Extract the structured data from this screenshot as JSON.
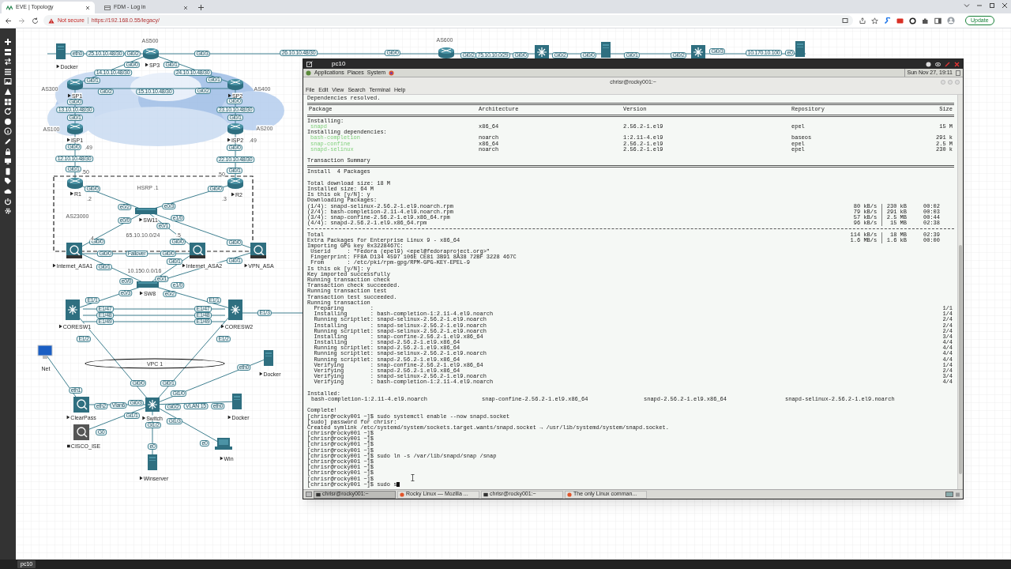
{
  "browser": {
    "tabs": [
      {
        "title": "EVE | Topology",
        "selected": true
      },
      {
        "title": "FDM - Log in",
        "selected": false
      }
    ],
    "security": "Not secure",
    "url": "https://192.168.0.55/legacy/",
    "update_button": "Update"
  },
  "diagram": {
    "nodes": [
      {
        "kind": "server",
        "label": "Docker",
        "stopped": false
      },
      {
        "kind": "router",
        "label": "SP3",
        "stopped": false
      },
      {
        "kind": "router"
      },
      {
        "kind": "l3switch"
      },
      {
        "kind": "server"
      },
      {
        "kind": "l3switch"
      },
      {
        "kind": "server"
      },
      {
        "kind": "router",
        "label": "SP1",
        "stopped": false
      },
      {
        "kind": "router",
        "label": "SP2",
        "stopped": false
      },
      {
        "kind": "router",
        "label": "ISP1",
        "stopped": false
      },
      {
        "kind": "router",
        "label": "ISP2",
        "stopped": false
      },
      {
        "kind": "router",
        "label": "R1",
        "stopped": false
      },
      {
        "kind": "router",
        "label": "R2",
        "stopped": false
      },
      {
        "kind": "switch",
        "label": "SW11",
        "stopped": false
      },
      {
        "kind": "firewall",
        "label": "Internet_ASA1",
        "stopped": false
      },
      {
        "kind": "firewall",
        "label": "Internet_ASA2",
        "stopped": false
      },
      {
        "kind": "firewall",
        "label": "VPN_ASA",
        "stopped": false
      },
      {
        "kind": "switch",
        "label": "SW8",
        "stopped": false
      },
      {
        "kind": "nexus",
        "label": "CORESW1",
        "stopped": false
      },
      {
        "kind": "nexus",
        "label": "CORESW2",
        "stopped": false
      },
      {
        "kind": "monitor",
        "label": "Net"
      },
      {
        "kind": "server",
        "label": "Docker",
        "stopped": false
      },
      {
        "kind": "clearpass",
        "label": "ClearPass",
        "stopped": false
      },
      {
        "kind": "l3switch",
        "label": "Switch",
        "stopped": false
      },
      {
        "kind": "server",
        "label": "Docker",
        "stopped": false
      },
      {
        "kind": "ise",
        "label": "CISCO_ISE",
        "stopped": true
      },
      {
        "kind": "laptop",
        "label": "Win",
        "stopped": false
      },
      {
        "kind": "server",
        "label": "Winserver",
        "stopped": false
      }
    ],
    "tags": [
      "eth0",
      "25.10.10.48/30",
      "Gi0/2",
      "Gi0/3",
      "26.10.10.48/30",
      "Gi0/0",
      "Gi0/2",
      "75.10.10.0/29",
      "Gi0/0",
      "Gi0/2",
      "Gi0/0",
      "Gi0/1",
      "Gi0/2",
      "Gi0/3",
      "10.170.10.100",
      "e0",
      "Gi0/0",
      "Gi0/1",
      "14.10.10.48/30",
      "24.10.10.48/30",
      "Gi0/1",
      "Gi0/1",
      "Gi0/2",
      "15.10.10.48/30",
      "Gi0/2",
      "Gi0/0",
      "Gi0/0",
      "13.10.10.48/30",
      "23.10.10.48/30",
      "Gi0/1",
      "Gi0/1",
      "Gi0/0",
      "Gi0/0",
      "12.10.10.48/30",
      "22.10.10.48/30",
      "Gi0/1",
      "Gi0/1",
      "Gi0/0",
      "Gi0/0",
      "e0/2",
      "e0/3",
      "e0/0",
      "e0/1",
      "e1/0",
      "Gi0/0",
      "Gi0/0",
      "Gi0/0",
      "Gi0/0",
      "Failover",
      "Gi0/0",
      "Gi0/1",
      "Gi0/1",
      "Gi0/1",
      "e0/0",
      "e0/1",
      "e1/0",
      "e0/3",
      "e0/2",
      "E1/1",
      "E1/1",
      "E1/47",
      "E1/48",
      "E1/49",
      "E1/47",
      "E1/48",
      "E1/49",
      "E1/3",
      "E1/2",
      "E1/2",
      "eth0",
      "Gi0/0",
      "Gi0/1",
      "eth1",
      "Gi1/0",
      "Gi0/3",
      "eth2",
      "Vlan6",
      "Gi0/2",
      "VLAN 15",
      "eth0",
      "Gi1/1",
      "Gi1/3",
      "G0",
      "Gi1/2",
      "e0",
      "e0"
    ],
    "annotations": [
      {
        "kind": "text",
        "text": "AS500"
      },
      {
        "kind": "text",
        "text": "AS600"
      },
      {
        "kind": "text",
        "text": "AS300"
      },
      {
        "kind": "text",
        "text": "AS400"
      },
      {
        "kind": "text",
        "text": "AS100"
      },
      {
        "kind": "text",
        "text": "AS200"
      },
      {
        "kind": "text",
        "text": ".49"
      },
      {
        "kind": "text",
        "text": ".49"
      },
      {
        "kind": "text",
        "text": ".50"
      },
      {
        "kind": "text",
        "text": ".50"
      },
      {
        "kind": "text",
        "text": ".2"
      },
      {
        "kind": "text",
        "text": ".3"
      },
      {
        "kind": "text",
        "text": "HSRP .1"
      },
      {
        "kind": "text",
        "text": "AS23000"
      },
      {
        "kind": "text",
        "text": "65.10.10.0/24"
      },
      {
        "kind": "text",
        "text": ".4"
      },
      {
        "kind": "text",
        "text": ".5"
      },
      {
        "kind": "text",
        "text": "10.150.0.0/16"
      },
      {
        "kind": "ellipse",
        "text": "VPC 1"
      }
    ]
  },
  "terminal": {
    "window_title": "pc10",
    "panel_menus": [
      "Applications",
      "Places",
      "System"
    ],
    "clock": "Sun Nov 27, 19:11",
    "title": "chrisr@rocky001:~",
    "menu": [
      "File",
      "Edit",
      "View",
      "Search",
      "Terminal",
      "Help"
    ],
    "lines": [
      {
        "kind": "text",
        "text": "Dependencies resolved."
      },
      {
        "kind": "double_rule"
      },
      {
        "kind": "header",
        "cells": [
          "Package",
          "Architecture",
          "Version",
          "Repository",
          "Size"
        ]
      },
      {
        "kind": "double_rule"
      },
      {
        "kind": "text",
        "text": "Installing:"
      },
      {
        "kind": "package",
        "cells": [
          "snapd",
          "x86_64",
          "2.56.2-1.el9",
          "epel",
          "15 M"
        ]
      },
      {
        "kind": "text",
        "text": "Installing dependencies:"
      },
      {
        "kind": "package",
        "cells": [
          "bash-completion",
          "noarch",
          "1:2.11-4.el9",
          "baseos",
          "291 k"
        ]
      },
      {
        "kind": "package",
        "cells": [
          "snap-confine",
          "x86_64",
          "2.56.2-1.el9",
          "epel",
          "2.5 M"
        ]
      },
      {
        "kind": "package",
        "cells": [
          "snapd-selinux",
          "noarch",
          "2.56.2-1.el9",
          "epel",
          "230 k"
        ]
      },
      {
        "kind": "blank"
      },
      {
        "kind": "text",
        "text": "Transaction Summary"
      },
      {
        "kind": "double_rule"
      },
      {
        "kind": "text",
        "text": "Install  4 Packages"
      },
      {
        "kind": "blank"
      },
      {
        "kind": "text",
        "text": "Total download size: 18 M"
      },
      {
        "kind": "text",
        "text": "Installed size: 64 M"
      },
      {
        "kind": "text",
        "text": "Is this ok [y/N]: y"
      },
      {
        "kind": "text",
        "text": "Downloading Packages:"
      },
      {
        "kind": "download",
        "text": "(1/4): snapd-selinux-2.56.2-1.el9.noarch.rpm",
        "right": "80 kB/s | 230 kB     00:02"
      },
      {
        "kind": "download",
        "text": "(2/4): bash-completion-2.11-4.el9.noarch.rpm",
        "right": "79 kB/s | 291 kB     00:03"
      },
      {
        "kind": "download",
        "text": "(3/4): snap-confine-2.56.2-1.el9.x86_64.rpm",
        "right": "57 kB/s | 2.5 MB     00:44"
      },
      {
        "kind": "download",
        "text": "(4/4): snapd-2.56.2-1.el9.x86_64.rpm",
        "right": "96 kB/s |  15 MB     02:38"
      },
      {
        "kind": "dashed_rule"
      },
      {
        "kind": "download",
        "text": "Total",
        "right": "114 kB/s |  18 MB     02:39"
      },
      {
        "kind": "download",
        "text": "Extra Packages for Enterprise Linux 9 - x86_64",
        "right": "1.6 MB/s | 1.6 kB     00:00"
      },
      {
        "kind": "text",
        "text": "Importing GPG key 0x3228467C:"
      },
      {
        "kind": "text",
        "text": " Userid     : \"Fedora (epel9) <epel@fedoraproject.org>\""
      },
      {
        "kind": "text",
        "text": " Fingerprint: FF8A D134 4597 106E CE81 3B91 8A38 72BF 3228 467C"
      },
      {
        "kind": "text",
        "text": " From       : /etc/pki/rpm-gpg/RPM-GPG-KEY-EPEL-9"
      },
      {
        "kind": "text",
        "text": "Is this ok [y/N]: y"
      },
      {
        "kind": "text",
        "text": "Key imported successfully"
      },
      {
        "kind": "text",
        "text": "Running transaction check"
      },
      {
        "kind": "text",
        "text": "Transaction check succeeded."
      },
      {
        "kind": "text",
        "text": "Running transaction test"
      },
      {
        "kind": "text",
        "text": "Transaction test succeeded."
      },
      {
        "kind": "text",
        "text": "Running transaction"
      },
      {
        "kind": "step",
        "text": "  Preparing        :",
        "right": "1/1"
      },
      {
        "kind": "step",
        "text": "  Installing       : bash-completion-1:2.11-4.el9.noarch",
        "right": "1/4"
      },
      {
        "kind": "step",
        "text": "  Running scriptlet: snapd-selinux-2.56.2-1.el9.noarch",
        "right": "2/4"
      },
      {
        "kind": "step",
        "text": "  Installing       : snapd-selinux-2.56.2-1.el9.noarch",
        "right": "2/4"
      },
      {
        "kind": "step",
        "text": "  Running scriptlet: snapd-selinux-2.56.2-1.el9.noarch",
        "right": "2/4"
      },
      {
        "kind": "step",
        "text": "  Installing       : snap-confine-2.56.2-1.el9.x86_64",
        "right": "3/4"
      },
      {
        "kind": "step",
        "text": "  Installing       : snapd-2.56.2-1.el9.x86_64",
        "right": "4/4"
      },
      {
        "kind": "step",
        "text": "  Running scriptlet: snapd-2.56.2-1.el9.x86_64",
        "right": "4/4"
      },
      {
        "kind": "step",
        "text": "  Running scriptlet: snapd-selinux-2.56.2-1.el9.noarch",
        "right": "4/4"
      },
      {
        "kind": "step",
        "text": "  Running scriptlet: snapd-2.56.2-1.el9.x86_64",
        "right": "4/4"
      },
      {
        "kind": "step",
        "text": "  Verifying        : snap-confine-2.56.2-1.el9.x86_64",
        "right": "1/4"
      },
      {
        "kind": "step",
        "text": "  Verifying        : snapd-2.56.2-1.el9.x86_64",
        "right": "2/4"
      },
      {
        "kind": "step",
        "text": "  Verifying        : snapd-selinux-2.56.2-1.el9.noarch",
        "right": "3/4"
      },
      {
        "kind": "step",
        "text": "  Verifying        : bash-completion-1:2.11-4.el9.noarch",
        "right": "4/4"
      },
      {
        "kind": "blank"
      },
      {
        "kind": "text",
        "text": "Installed:"
      },
      {
        "kind": "installed",
        "cells": [
          "bash-completion-1:2.11-4.el9.noarch",
          "snap-confine-2.56.2-1.el9.x86_64",
          "snapd-2.56.2-1.el9.x86_64",
          "snapd-selinux-2.56.2-1.el9.noarch"
        ]
      },
      {
        "kind": "blank"
      },
      {
        "kind": "text",
        "text": "Complete!"
      },
      {
        "kind": "text",
        "text": "[chrisr@rocky001 ~]$ sudo systemctl enable --now snapd.socket"
      },
      {
        "kind": "text",
        "text": "[sudo] password for chrisr:"
      },
      {
        "kind": "text",
        "text": "Created symlink /etc/systemd/system/sockets.target.wants/snapd.socket → /usr/lib/systemd/system/snapd.socket."
      },
      {
        "kind": "text",
        "text": "[chrisr@rocky001 ~]$"
      },
      {
        "kind": "text",
        "text": "[chrisr@rocky001 ~]$"
      },
      {
        "kind": "text",
        "text": "[chrisr@rocky001 ~]$"
      },
      {
        "kind": "text",
        "text": "[chrisr@rocky001 ~]$"
      },
      {
        "kind": "text",
        "text": "[chrisr@rocky001 ~]$ sudo ln -s /var/lib/snapd/snap /snap"
      },
      {
        "kind": "text",
        "text": "[chrisr@rocky001 ~]$"
      },
      {
        "kind": "text",
        "text": "[chrisr@rocky001 ~]$"
      },
      {
        "kind": "text",
        "text": "[chrisr@rocky001 ~]$"
      },
      {
        "kind": "text",
        "text": "[chrisr@rocky001 ~]$"
      },
      {
        "kind": "input",
        "text": "[chrisr@rocky001 ~]$ sudo s"
      }
    ],
    "tasks": [
      {
        "label": "chrisr@rocky001:~",
        "selected": true
      },
      {
        "label": "Rocky Linux — Mozilla ...",
        "selected": false
      },
      {
        "label": "chrisr@rocky001:~",
        "selected": false
      },
      {
        "label": "The only Linux comman...",
        "selected": false
      }
    ]
  },
  "bottom_bar": {
    "items": [
      "pc10"
    ]
  }
}
